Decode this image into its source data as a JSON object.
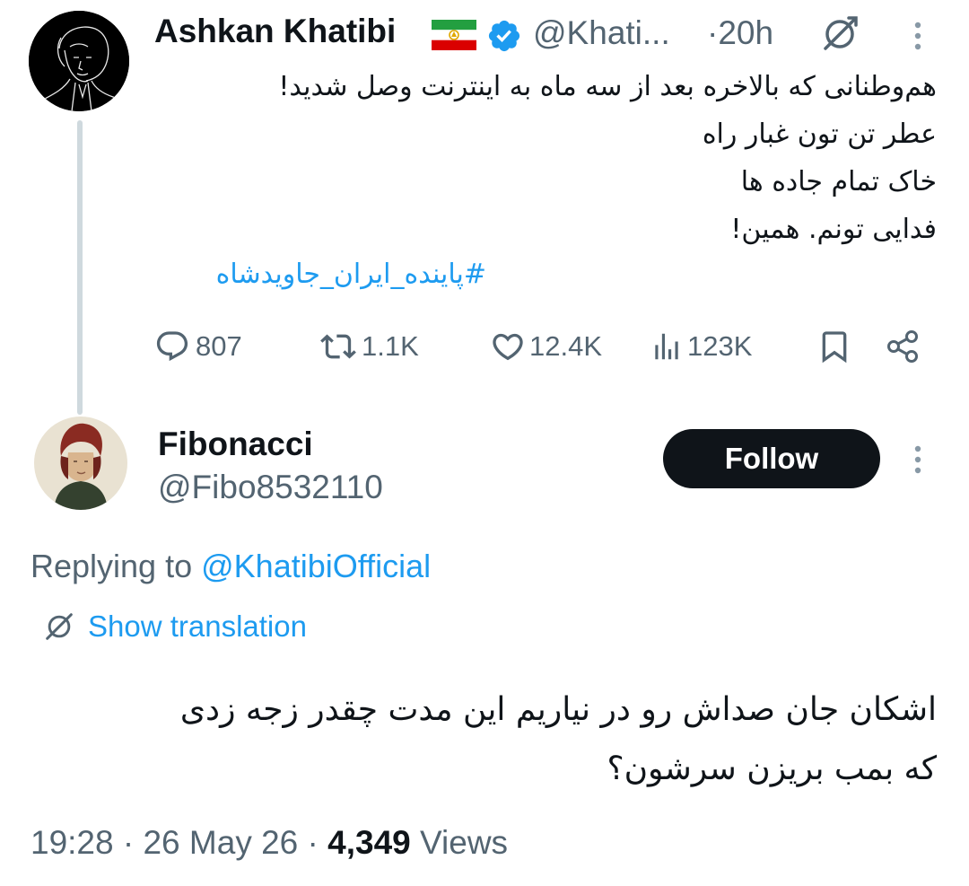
{
  "tweet": {
    "author_name": "Ashkan Khatibi",
    "author_handle": "@Khati...",
    "separator": "·",
    "time": "20h",
    "lines": [
      "هم‌وطنانی که بالاخره بعد از سه ماه به اینترنت وصل شدید!",
      "عطر تن تون غبار راه",
      "خاک تمام جاده ها",
      "فدایی تونم. همین!"
    ],
    "hashtag": "#پاینده_ایران_جاویدشاه",
    "stats": {
      "replies": "807",
      "reposts": "1.1K",
      "likes": "12.4K",
      "views": "123K"
    },
    "icons": [
      "flag-icon",
      "verified-badge-icon",
      "translate-icon",
      "more-icon",
      "reply-icon",
      "repost-icon",
      "like-icon",
      "views-icon",
      "bookmark-icon",
      "share-icon"
    ]
  },
  "reply": {
    "author_name": "Fibonacci",
    "author_handle": "@Fibo8532110",
    "follow_label": "Follow",
    "replying_prefix": "Replying to",
    "replying_to": "@KhatibiOfficial",
    "show_translation": "Show translation",
    "lines": [
      "اشکان جان صداش رو در نیاریم این مدت چقدر زجه زدی",
      "که بمب بریزن سرشون؟"
    ],
    "time": "19:28",
    "date": "26 May 26",
    "views_count": "4,349",
    "views_label": "Views",
    "separator": "·"
  },
  "colors": {
    "text": "#0f1419",
    "secondary": "#536471",
    "accent": "#1d9bf0",
    "thread_line": "#cfd9de",
    "button": "#0f1419"
  }
}
